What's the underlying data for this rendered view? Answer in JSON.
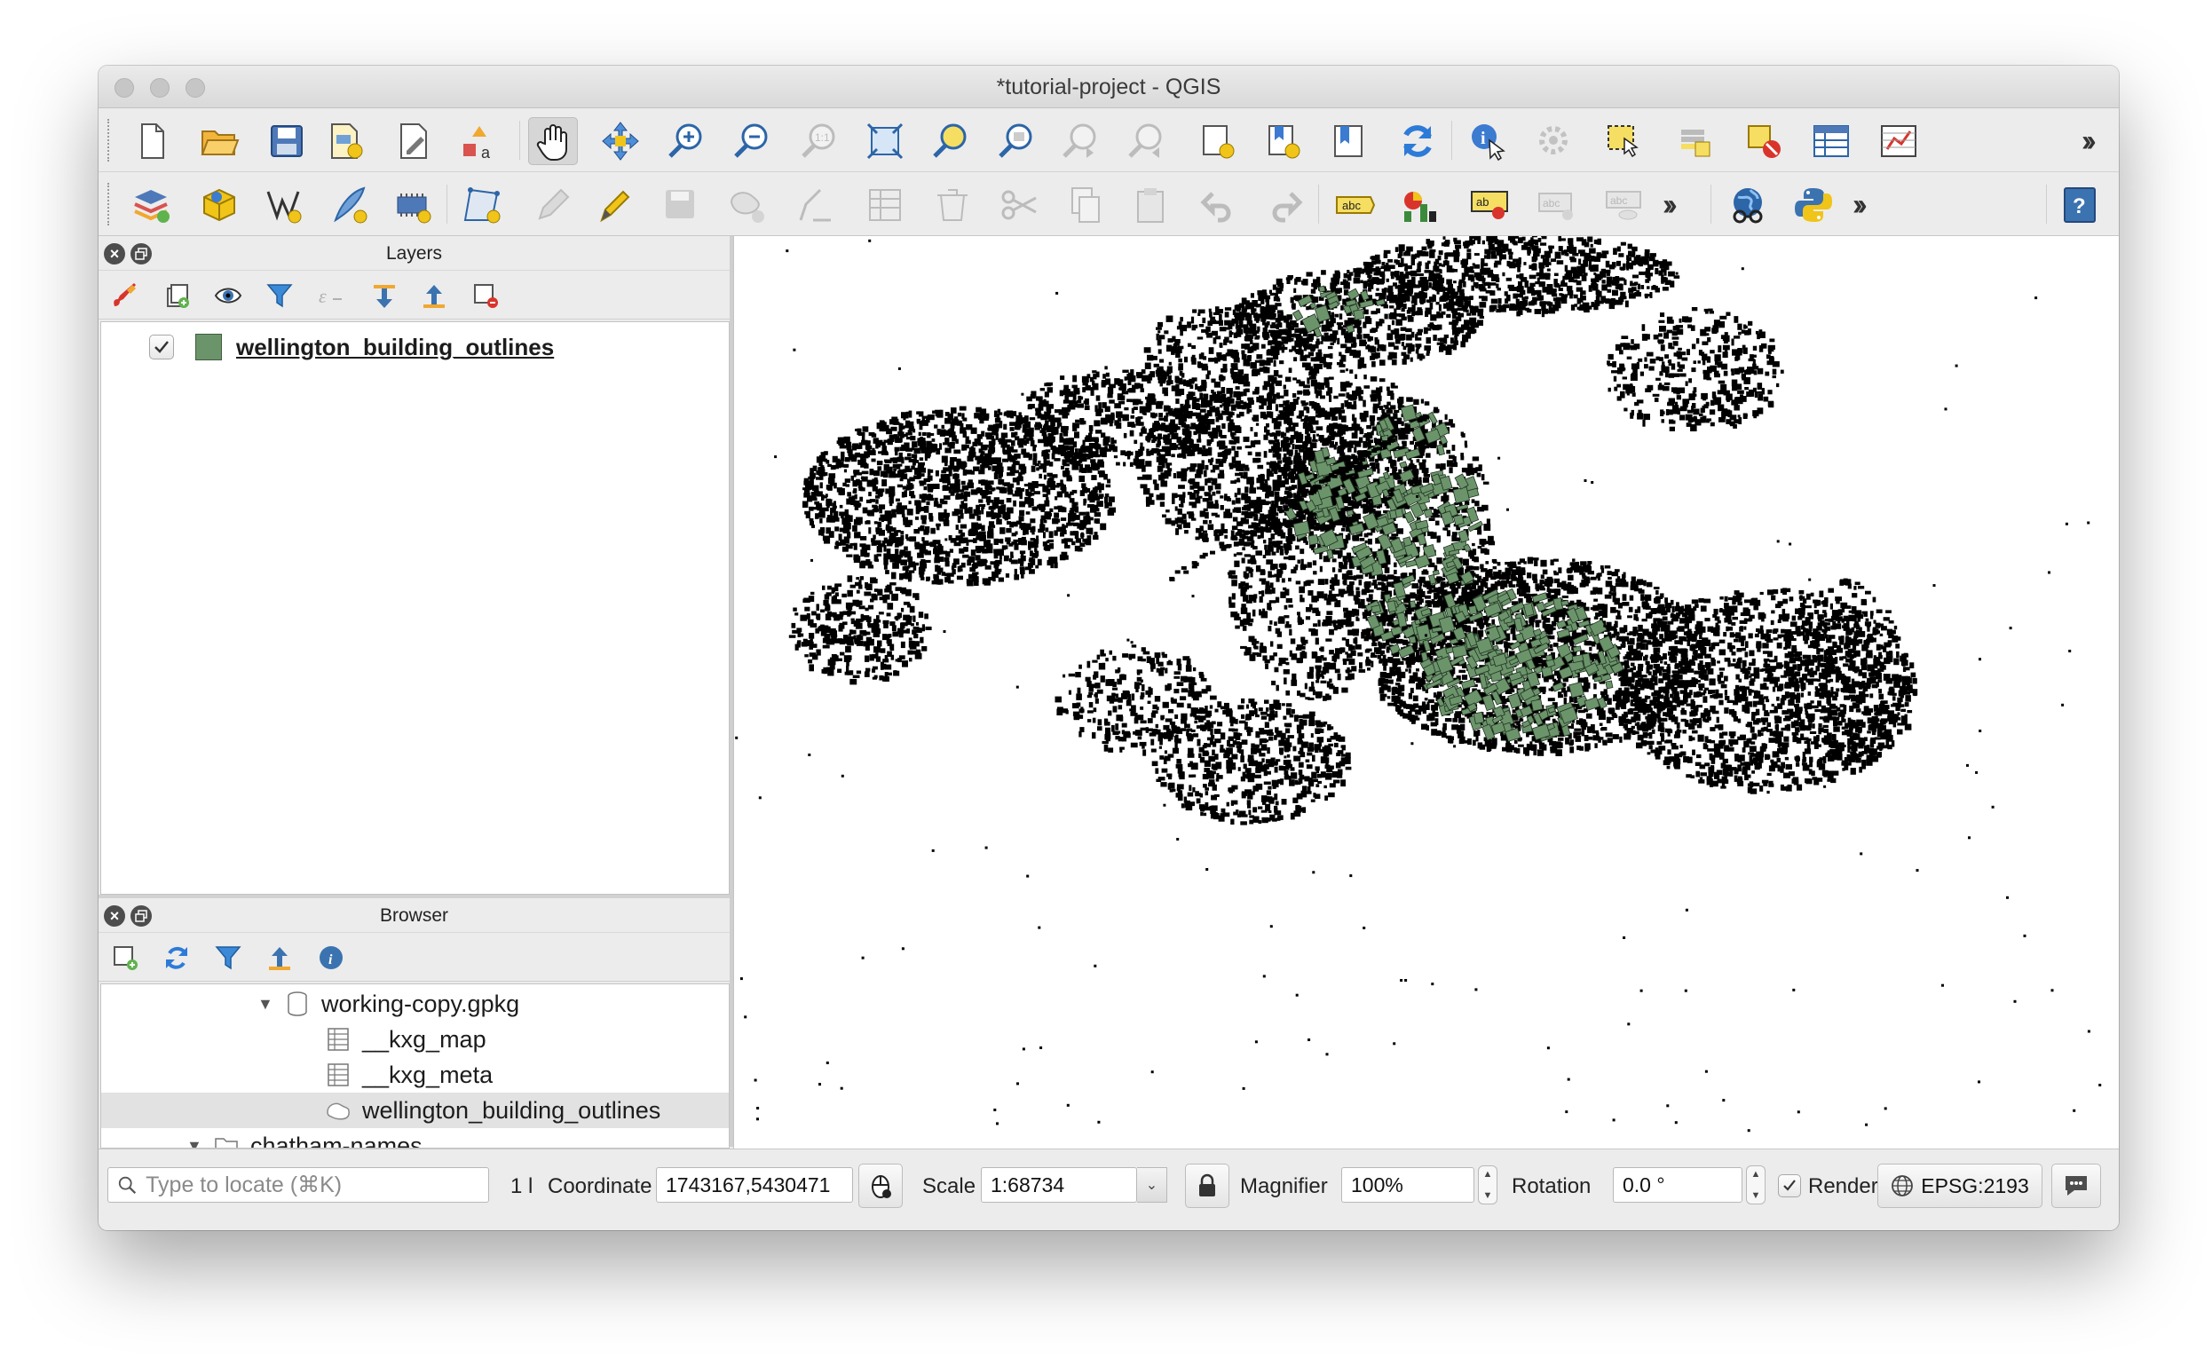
{
  "window": {
    "title": "*tutorial-project - QGIS"
  },
  "toolbar1": {
    "icons": [
      "new-project-icon",
      "open-project-icon",
      "save-project-icon",
      "print-layout-icon",
      "layout-manager-icon",
      "style-manager-icon",
      "pan-icon",
      "pan-to-selection-icon",
      "zoom-in-icon",
      "zoom-out-icon",
      "zoom-native-icon",
      "zoom-full-icon",
      "zoom-to-selection-icon",
      "zoom-to-layer-icon",
      "zoom-last-icon",
      "zoom-next-icon",
      "new-bookmark-icon",
      "show-bookmarks-icon",
      "temporal-icon",
      "refresh-icon",
      "identify-icon",
      "actions-icon",
      "select-features-icon",
      "select-by-value-icon",
      "deselect-icon",
      "attribute-table-icon",
      "statistics-icon"
    ]
  },
  "toolbar2": {
    "icons": [
      "data-source-manager-icon",
      "new-geopackage-layer-icon",
      "new-shapefile-layer-icon",
      "new-spatialite-layer-icon",
      "new-memory-layer-icon",
      "current-edits-icon",
      "toggle-editing-icon",
      "save-edits-icon",
      "digitize-icon",
      "vertex-tool-icon",
      "modify-attributes-icon",
      "delete-selected-icon",
      "cut-features-icon",
      "copy-features-icon",
      "paste-features-icon",
      "undo-icon",
      "redo-icon",
      "label-icon",
      "diagram-icon",
      "pin-label-icon",
      "highlight-pinned-icon",
      "show-hide-labels-icon",
      "plugin-globe-icon",
      "python-icon",
      "help-icon"
    ]
  },
  "layers_panel": {
    "title": "Layers",
    "layer": {
      "name": "wellington_building_outlines",
      "checked": true,
      "color": "#6b946b"
    }
  },
  "browser_panel": {
    "title": "Browser",
    "items": [
      {
        "label": "working-copy.gpkg",
        "type": "database"
      },
      {
        "label": "__kxg_map",
        "type": "table"
      },
      {
        "label": "__kxg_meta",
        "type": "table"
      },
      {
        "label": "wellington_building_outlines",
        "type": "polygon"
      },
      {
        "label": "chatham-names",
        "type": "folder"
      }
    ]
  },
  "statusbar": {
    "locator_placeholder": "Type to locate (⌘K)",
    "legend_count": "1 l",
    "coordinate_label": "Coordinate",
    "coordinate_value": "1743167,5430471",
    "scale_label": "Scale",
    "scale_value": "1:68734",
    "magnifier_label": "Magnifier",
    "magnifier_value": "100%",
    "rotation_label": "Rotation",
    "rotation_value": "0.0 °",
    "render_label": "Render",
    "render_checked": true,
    "crs": "EPSG:2193"
  },
  "colors": {
    "building_fill_highlight": "#6b946b",
    "building_outline": "#000000",
    "map_background": "#ffffff"
  }
}
